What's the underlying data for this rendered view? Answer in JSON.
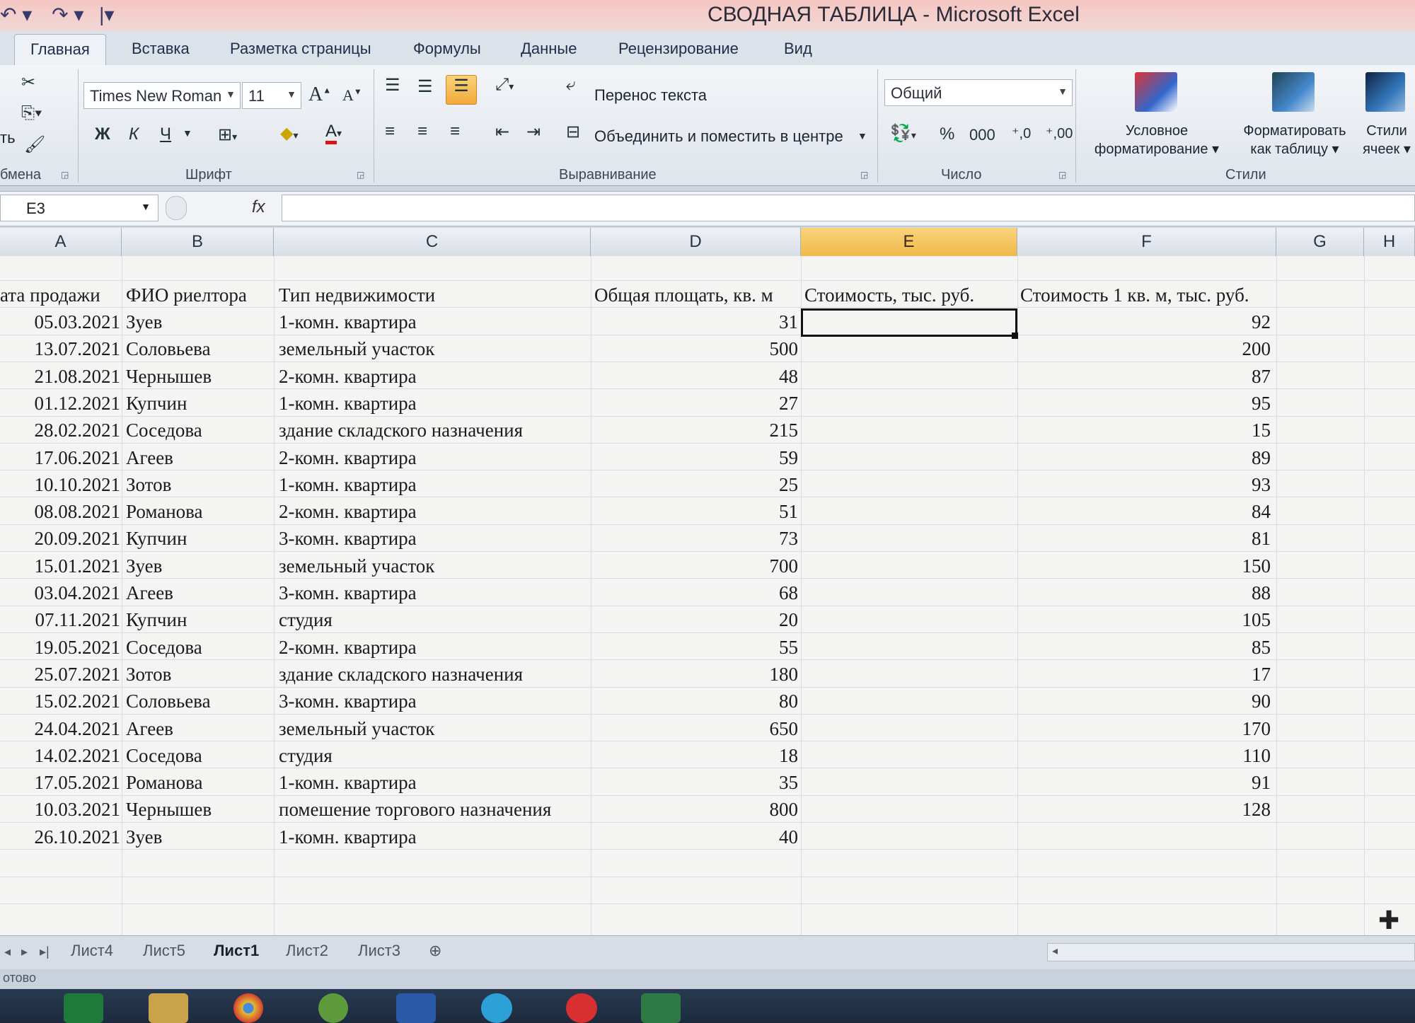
{
  "window": {
    "title": "СВОДНАЯ ТАБЛИЦА - Microsoft Excel"
  },
  "tabs": [
    "Главная",
    "Вставка",
    "Разметка страницы",
    "Формулы",
    "Данные",
    "Рецензирование",
    "Вид"
  ],
  "active_tab": "Главная",
  "ribbon": {
    "clipboard": {
      "label": "Буфер обмена",
      "label_visible": "бмена",
      "paste_partial": "ть"
    },
    "font": {
      "label": "Шрифт",
      "font_name": "Times New Roman",
      "font_size": "11",
      "bold": "Ж",
      "italic": "К",
      "underline": "Ч",
      "font_color_letter": "A",
      "grow_font": "A",
      "shrink_font": "A"
    },
    "alignment": {
      "label": "Выравнивание",
      "wrap_text": "Перенос текста",
      "merge_center": "Объединить и поместить в центре"
    },
    "number": {
      "label": "Число",
      "format": "Общий",
      "percent": "%",
      "thousands": "000"
    },
    "styles": {
      "label": "Стили",
      "conditional_line1": "Условное",
      "conditional_line2": "форматирование",
      "format_table_line1": "Форматировать",
      "format_table_line2": "как таблицу",
      "cell_styles_line1": "Стили",
      "cell_styles_line2": "ячеек"
    }
  },
  "formula_bar": {
    "name_box": "E3",
    "fx": "fx",
    "value": ""
  },
  "columns": [
    "A",
    "B",
    "C",
    "D",
    "E",
    "F",
    "G",
    "H"
  ],
  "selected_column": "E",
  "headers": {
    "a": "ата продажи",
    "b": "ФИО риелтора",
    "c": "Тип недвижимости",
    "d": "Общая площать, кв. м",
    "e": "Стоимость, тыс. руб.",
    "f": "Стоимость 1 кв. м, тыс. руб."
  },
  "rows": [
    [
      "05.03.2021",
      "Зуев",
      "1-комн. квартира",
      "31",
      "",
      "92"
    ],
    [
      "13.07.2021",
      "Соловьева",
      "земельный участок",
      "500",
      "",
      "200"
    ],
    [
      "21.08.2021",
      "Чернышев",
      "2-комн. квартира",
      "48",
      "",
      "87"
    ],
    [
      "01.12.2021",
      "Купчин",
      "1-комн. квартира",
      "27",
      "",
      "95"
    ],
    [
      "28.02.2021",
      "Соседова",
      "здание складского назначения",
      "215",
      "",
      "15"
    ],
    [
      "17.06.2021",
      "Агеев",
      "2-комн. квартира",
      "59",
      "",
      "89"
    ],
    [
      "10.10.2021",
      "Зотов",
      "1-комн. квартира",
      "25",
      "",
      "93"
    ],
    [
      "08.08.2021",
      "Романова",
      "2-комн. квартира",
      "51",
      "",
      "84"
    ],
    [
      "20.09.2021",
      "Купчин",
      "3-комн. квартира",
      "73",
      "",
      "81"
    ],
    [
      "15.01.2021",
      "Зуев",
      "земельный участок",
      "700",
      "",
      "150"
    ],
    [
      "03.04.2021",
      "Агеев",
      "3-комн. квартира",
      "68",
      "",
      "88"
    ],
    [
      "07.11.2021",
      "Купчин",
      "студия",
      "20",
      "",
      "105"
    ],
    [
      "19.05.2021",
      "Соседова",
      "2-комн. квартира",
      "55",
      "",
      "85"
    ],
    [
      "25.07.2021",
      "Зотов",
      "здание складского назначения",
      "180",
      "",
      "17"
    ],
    [
      "15.02.2021",
      "Соловьева",
      "3-комн. квартира",
      "80",
      "",
      "90"
    ],
    [
      "24.04.2021",
      "Агеев",
      "земельный участок",
      "650",
      "",
      "170"
    ],
    [
      "14.02.2021",
      "Соседова",
      "студия",
      "18",
      "",
      "110"
    ],
    [
      "17.05.2021",
      "Романова",
      "1-комн. квартира",
      "35",
      "",
      "91"
    ],
    [
      "10.03.2021",
      "Чернышев",
      "помешение торгового назначения",
      "800",
      "",
      "128"
    ],
    [
      "26.10.2021",
      "Зуев",
      "1-комн. квартира",
      "40",
      "",
      ""
    ]
  ],
  "sheet_tabs": [
    "Лист4",
    "Лист5",
    "Лист1",
    "Лист2",
    "Лист3"
  ],
  "active_sheet": "Лист1",
  "status": "отово",
  "taskbar_apps": [
    "store",
    "explorer",
    "chrome",
    "torrent",
    "word",
    "telegram",
    "yandex",
    "excel"
  ],
  "colors": {
    "selected_column": "#f1b94a",
    "title_bar": "#f5c6c1",
    "sheet_bg": "#f4f5f3"
  }
}
